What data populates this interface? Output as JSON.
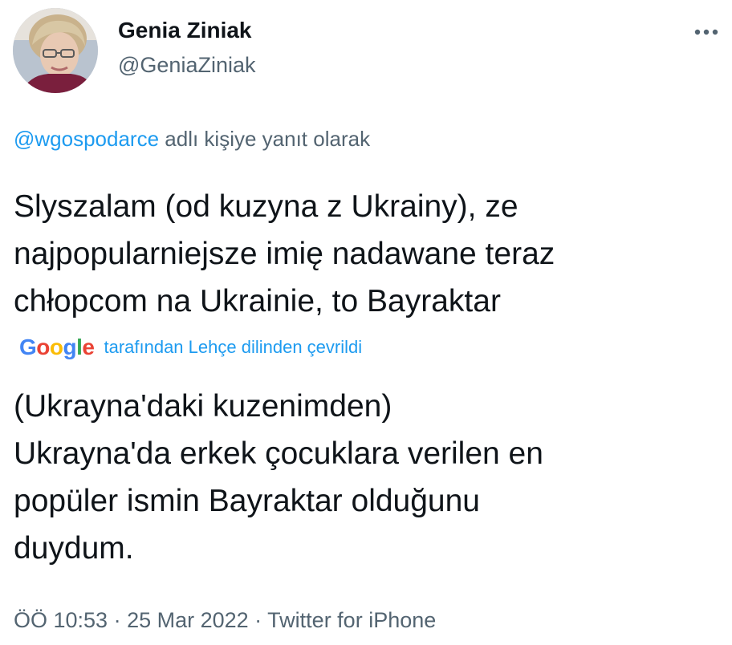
{
  "author": {
    "display_name": "Genia Ziniak",
    "handle": "@GeniaZiniak"
  },
  "header": {
    "more_icon": "more-horizontal-icon"
  },
  "reply": {
    "mention": "@wgospodarce",
    "suffix": " adlı kişiye yanıt olarak"
  },
  "tweet": {
    "text_lines": [
      "Slyszalam (od kuzyna z Ukrainy), ze",
      "najpopularniejsze imię nadawane teraz",
      "chłopcom na Ukrainie, to Bayraktar"
    ]
  },
  "translation": {
    "logo_letters": [
      "G",
      "o",
      "o",
      "g",
      "l",
      "e"
    ],
    "logo_colors": [
      "#4285f4",
      "#ea4335",
      "#fbbc05",
      "#4285f4",
      "#34a853",
      "#ea4335"
    ],
    "label": "tarafından Lehçe dilinden çevrildi",
    "text_lines": [
      "(Ukrayna'daki kuzenimden)",
      "Ukrayna'da erkek çocuklara verilen en",
      "popüler ismin Bayraktar olduğunu",
      "duydum."
    ]
  },
  "meta": {
    "text": "ÖÖ 10:53 · 25 Mar 2022 · Twitter for iPhone"
  },
  "colors": {
    "link": "#1d9bf0",
    "secondary_text": "#536471",
    "primary_text": "#0f1419"
  }
}
